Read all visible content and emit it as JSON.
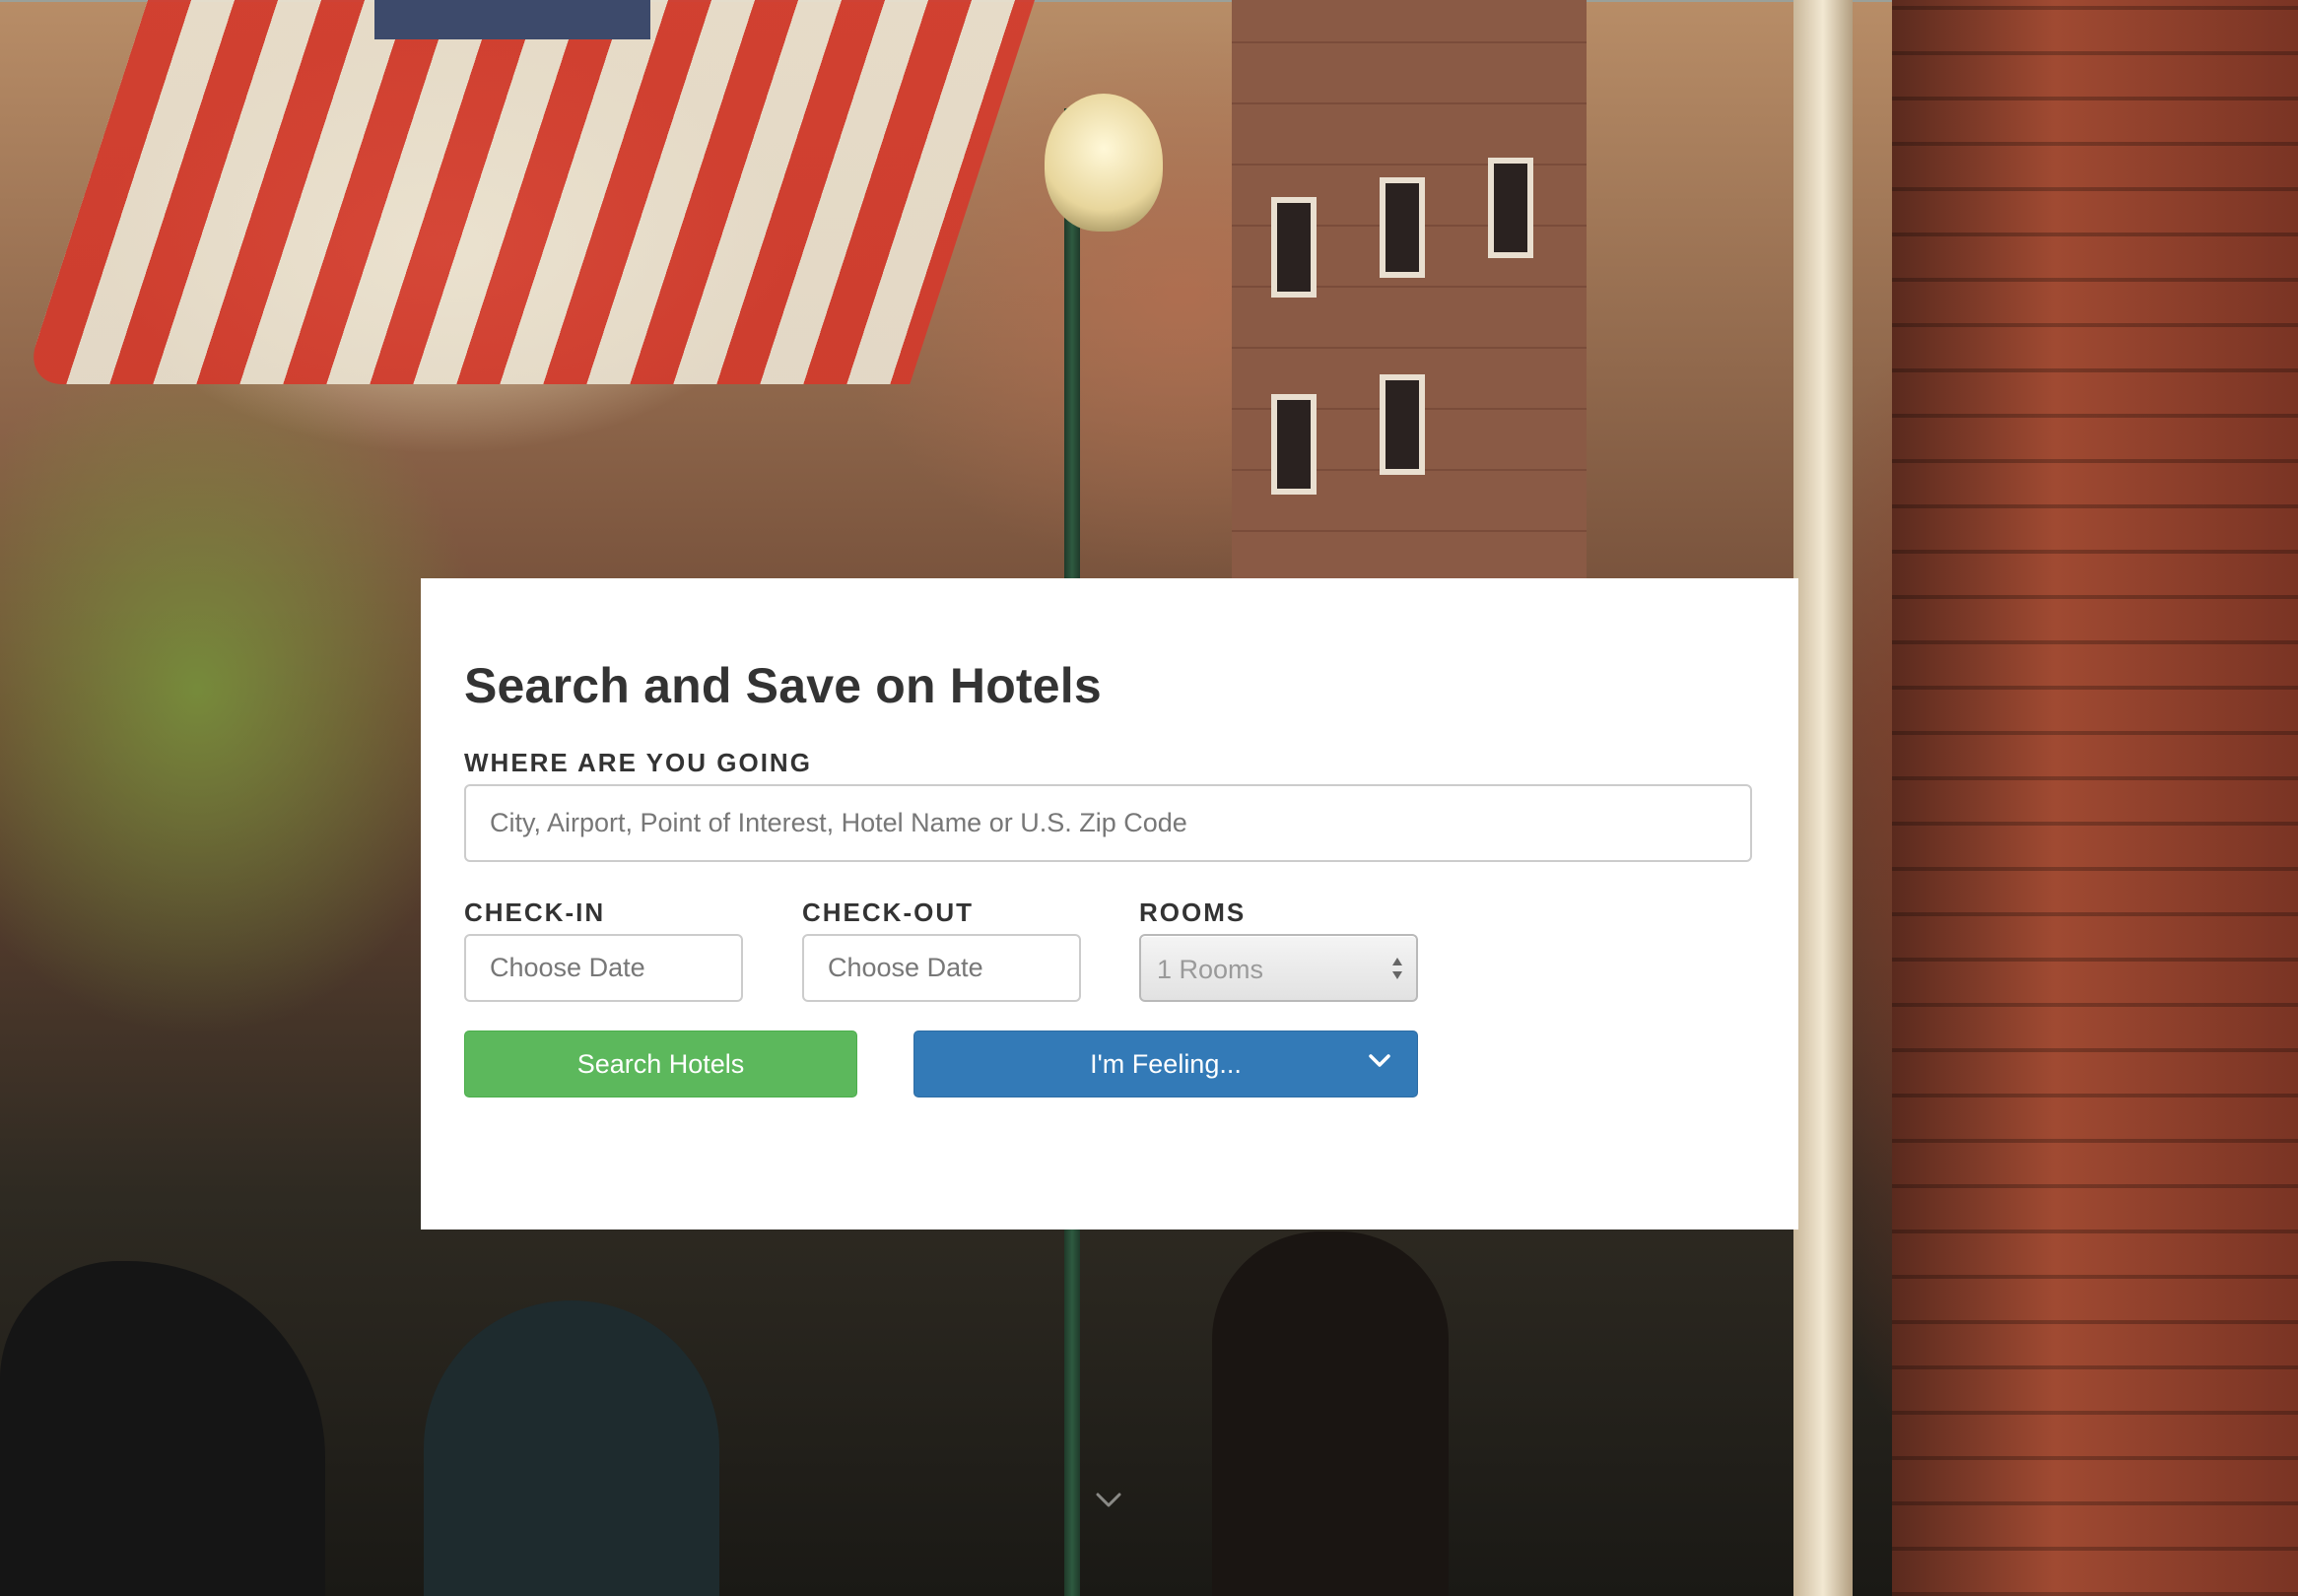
{
  "hero": {
    "background": "street scene with american flag, lamp post and brick buildings"
  },
  "search_panel": {
    "title": "Search and Save on Hotels",
    "destination": {
      "label": "WHERE ARE YOU GOING",
      "placeholder": "City, Airport, Point of Interest, Hotel Name or U.S. Zip Code",
      "value": ""
    },
    "check_in": {
      "label": "CHECK-IN",
      "placeholder": "Choose Date"
    },
    "check_out": {
      "label": "CHECK-OUT",
      "placeholder": "Choose Date"
    },
    "rooms": {
      "label": "ROOMS",
      "selected": "1 Rooms"
    },
    "search_button_label": "Search Hotels",
    "feeling_button_label": "I'm Feeling..."
  },
  "icons": {
    "rooms_select_arrows": "select-arrows-icon",
    "feeling_dropdown": "chevron-down-icon",
    "scroll_down": "chevron-down-icon"
  },
  "colors": {
    "search_button": "#5cb85c",
    "feeling_button": "#337ab7",
    "panel_background": "#ffffff",
    "title_text": "#333333"
  }
}
